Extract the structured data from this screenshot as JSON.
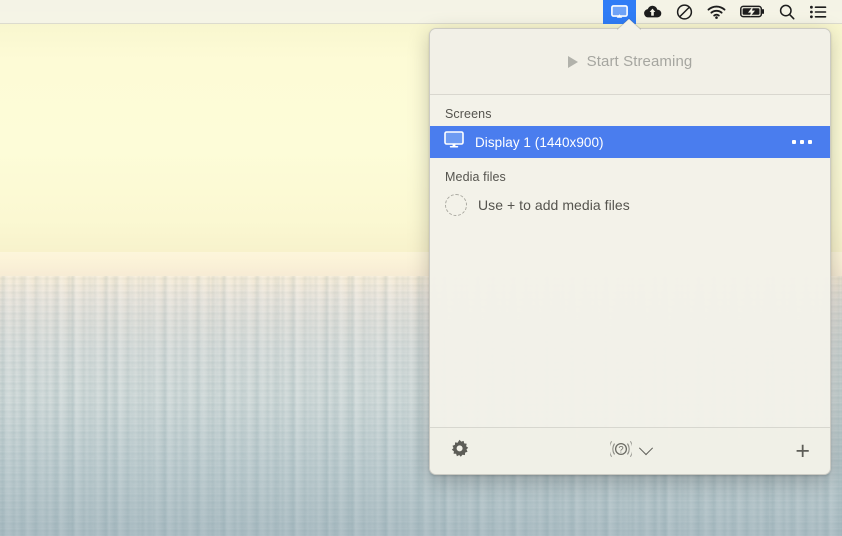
{
  "menubar": {
    "items": [
      {
        "name": "airplay-display-icon",
        "label": "Screen Streaming",
        "active": true
      },
      {
        "name": "cloud-upload-icon",
        "label": "Cloud Upload",
        "active": false
      },
      {
        "name": "do-not-disturb-icon",
        "label": "Do Not Disturb",
        "active": false
      },
      {
        "name": "wifi-icon",
        "label": "Wi-Fi",
        "active": false
      },
      {
        "name": "battery-charging-icon",
        "label": "Battery Charging",
        "active": false
      },
      {
        "name": "search-icon",
        "label": "Spotlight Search",
        "active": false
      },
      {
        "name": "control-center-icon",
        "label": "Control Center",
        "active": false
      }
    ]
  },
  "panel": {
    "header": {
      "start_streaming_label": "Start Streaming",
      "disabled": true
    },
    "screens": {
      "section_label": "Screens",
      "items": [
        {
          "label": "Display 1 (1440x900)",
          "resolution": "1440x900",
          "selected": true,
          "more_label": "•••"
        }
      ]
    },
    "media": {
      "section_label": "Media files",
      "empty_label": "Use + to add media files"
    },
    "footer": {
      "settings_label": "Settings",
      "help_label": "Help",
      "dropdown_label": "More options",
      "add_label": "+"
    }
  },
  "colors": {
    "accent_blue": "#4a7dee",
    "menubar_active_blue": "#2f7cf6",
    "panel_bg": "#f3f2e9",
    "text_primary": "#1d1d1d",
    "text_secondary": "#55544e",
    "text_disabled": "#a6a6a0"
  }
}
